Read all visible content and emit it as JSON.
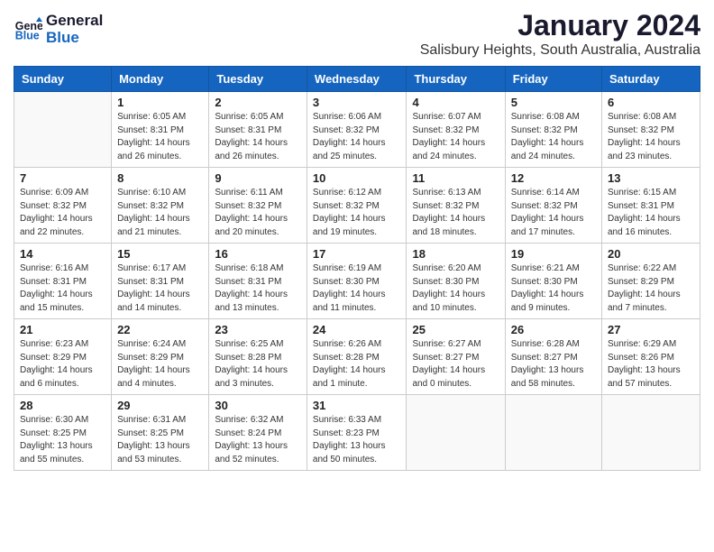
{
  "logo": {
    "line1": "General",
    "line2": "Blue"
  },
  "title": "January 2024",
  "subtitle": "Salisbury Heights, South Australia, Australia",
  "weekdays": [
    "Sunday",
    "Monday",
    "Tuesday",
    "Wednesday",
    "Thursday",
    "Friday",
    "Saturday"
  ],
  "weeks": [
    [
      {
        "day": "",
        "info": ""
      },
      {
        "day": "1",
        "info": "Sunrise: 6:05 AM\nSunset: 8:31 PM\nDaylight: 14 hours\nand 26 minutes."
      },
      {
        "day": "2",
        "info": "Sunrise: 6:05 AM\nSunset: 8:31 PM\nDaylight: 14 hours\nand 26 minutes."
      },
      {
        "day": "3",
        "info": "Sunrise: 6:06 AM\nSunset: 8:32 PM\nDaylight: 14 hours\nand 25 minutes."
      },
      {
        "day": "4",
        "info": "Sunrise: 6:07 AM\nSunset: 8:32 PM\nDaylight: 14 hours\nand 24 minutes."
      },
      {
        "day": "5",
        "info": "Sunrise: 6:08 AM\nSunset: 8:32 PM\nDaylight: 14 hours\nand 24 minutes."
      },
      {
        "day": "6",
        "info": "Sunrise: 6:08 AM\nSunset: 8:32 PM\nDaylight: 14 hours\nand 23 minutes."
      }
    ],
    [
      {
        "day": "7",
        "info": "Sunrise: 6:09 AM\nSunset: 8:32 PM\nDaylight: 14 hours\nand 22 minutes."
      },
      {
        "day": "8",
        "info": "Sunrise: 6:10 AM\nSunset: 8:32 PM\nDaylight: 14 hours\nand 21 minutes."
      },
      {
        "day": "9",
        "info": "Sunrise: 6:11 AM\nSunset: 8:32 PM\nDaylight: 14 hours\nand 20 minutes."
      },
      {
        "day": "10",
        "info": "Sunrise: 6:12 AM\nSunset: 8:32 PM\nDaylight: 14 hours\nand 19 minutes."
      },
      {
        "day": "11",
        "info": "Sunrise: 6:13 AM\nSunset: 8:32 PM\nDaylight: 14 hours\nand 18 minutes."
      },
      {
        "day": "12",
        "info": "Sunrise: 6:14 AM\nSunset: 8:32 PM\nDaylight: 14 hours\nand 17 minutes."
      },
      {
        "day": "13",
        "info": "Sunrise: 6:15 AM\nSunset: 8:31 PM\nDaylight: 14 hours\nand 16 minutes."
      }
    ],
    [
      {
        "day": "14",
        "info": "Sunrise: 6:16 AM\nSunset: 8:31 PM\nDaylight: 14 hours\nand 15 minutes."
      },
      {
        "day": "15",
        "info": "Sunrise: 6:17 AM\nSunset: 8:31 PM\nDaylight: 14 hours\nand 14 minutes."
      },
      {
        "day": "16",
        "info": "Sunrise: 6:18 AM\nSunset: 8:31 PM\nDaylight: 14 hours\nand 13 minutes."
      },
      {
        "day": "17",
        "info": "Sunrise: 6:19 AM\nSunset: 8:30 PM\nDaylight: 14 hours\nand 11 minutes."
      },
      {
        "day": "18",
        "info": "Sunrise: 6:20 AM\nSunset: 8:30 PM\nDaylight: 14 hours\nand 10 minutes."
      },
      {
        "day": "19",
        "info": "Sunrise: 6:21 AM\nSunset: 8:30 PM\nDaylight: 14 hours\nand 9 minutes."
      },
      {
        "day": "20",
        "info": "Sunrise: 6:22 AM\nSunset: 8:29 PM\nDaylight: 14 hours\nand 7 minutes."
      }
    ],
    [
      {
        "day": "21",
        "info": "Sunrise: 6:23 AM\nSunset: 8:29 PM\nDaylight: 14 hours\nand 6 minutes."
      },
      {
        "day": "22",
        "info": "Sunrise: 6:24 AM\nSunset: 8:29 PM\nDaylight: 14 hours\nand 4 minutes."
      },
      {
        "day": "23",
        "info": "Sunrise: 6:25 AM\nSunset: 8:28 PM\nDaylight: 14 hours\nand 3 minutes."
      },
      {
        "day": "24",
        "info": "Sunrise: 6:26 AM\nSunset: 8:28 PM\nDaylight: 14 hours\nand 1 minute."
      },
      {
        "day": "25",
        "info": "Sunrise: 6:27 AM\nSunset: 8:27 PM\nDaylight: 14 hours\nand 0 minutes."
      },
      {
        "day": "26",
        "info": "Sunrise: 6:28 AM\nSunset: 8:27 PM\nDaylight: 13 hours\nand 58 minutes."
      },
      {
        "day": "27",
        "info": "Sunrise: 6:29 AM\nSunset: 8:26 PM\nDaylight: 13 hours\nand 57 minutes."
      }
    ],
    [
      {
        "day": "28",
        "info": "Sunrise: 6:30 AM\nSunset: 8:25 PM\nDaylight: 13 hours\nand 55 minutes."
      },
      {
        "day": "29",
        "info": "Sunrise: 6:31 AM\nSunset: 8:25 PM\nDaylight: 13 hours\nand 53 minutes."
      },
      {
        "day": "30",
        "info": "Sunrise: 6:32 AM\nSunset: 8:24 PM\nDaylight: 13 hours\nand 52 minutes."
      },
      {
        "day": "31",
        "info": "Sunrise: 6:33 AM\nSunset: 8:23 PM\nDaylight: 13 hours\nand 50 minutes."
      },
      {
        "day": "",
        "info": ""
      },
      {
        "day": "",
        "info": ""
      },
      {
        "day": "",
        "info": ""
      }
    ]
  ]
}
